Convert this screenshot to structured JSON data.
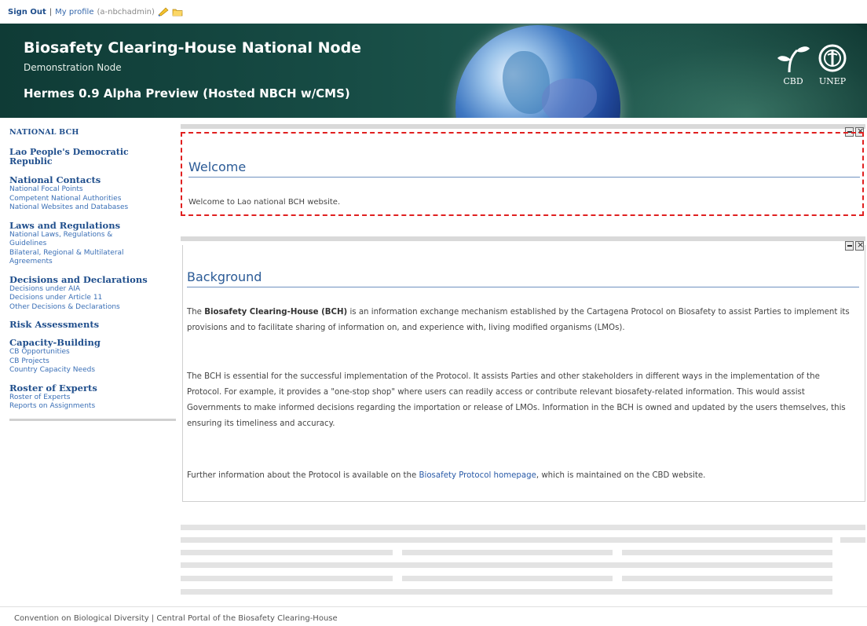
{
  "topbar": {
    "sign_out": "Sign Out",
    "separator": "|",
    "my_profile": "My profile",
    "username": "(a-nbchadmin)"
  },
  "banner": {
    "title": "Biosafety Clearing-House National Node",
    "subtitle": "Demonstration Node",
    "tag": "Hermes 0.9 Alpha Preview (Hosted NBCH w/CMS)",
    "logo_cbd": "CBD",
    "logo_unep": "UNEP"
  },
  "sidebar": {
    "heading": "NATIONAL BCH",
    "country": "Lao People's Democratic Republic",
    "sections": [
      {
        "title": "National Contacts",
        "links": [
          "National Focal Points",
          "Competent National Authorities",
          "National Websites and Databases"
        ]
      },
      {
        "title": "Laws and Regulations",
        "links": [
          "National Laws, Regulations & Guidelines",
          "Bilateral, Regional & Multilateral Agreements"
        ]
      },
      {
        "title": "Decisions and Declarations",
        "links": [
          "Decisions under AIA",
          "Decisions under Article 11",
          "Other Decisions & Declarations"
        ]
      },
      {
        "title": "Risk Assessments",
        "links": []
      },
      {
        "title": "Capacity-Building",
        "links": [
          "CB Opportunities",
          "CB Projects",
          "Country Capacity Needs"
        ]
      },
      {
        "title": "Roster of Experts",
        "links": [
          "Roster of Experts",
          "Reports on Assignments"
        ]
      }
    ]
  },
  "welcome": {
    "heading": "Welcome",
    "body": "Welcome to Lao national BCH website."
  },
  "background": {
    "heading": "Background",
    "p1_pre": "The ",
    "p1_bold": "Biosafety Clearing-House (BCH)",
    "p1_post": " is an information exchange mechanism established by the Cartagena Protocol on Biosafety to assist Parties to implement its provisions and to facilitate sharing of information on, and experience with, living modified organisms (LMOs).",
    "p2": "The BCH is essential for the successful implementation of the Protocol. It assists Parties and other stakeholders in different ways in the implementation of the Protocol. For example, it provides a \"one-stop shop\" where users can readily access or contribute relevant biosafety-related information. This would assist Governments to make informed decisions regarding the importation or release of LMOs. Information in the BCH is owned and updated by the users themselves, this ensuring its timeliness and accuracy.",
    "p3_pre": "Further information about the Protocol is available on the ",
    "p3_link": "Biosafety Protocol homepage",
    "p3_post": ", which is maintained on the CBD website."
  },
  "footer": {
    "text": "Convention on Biological Diversity | Central Portal of the Biosafety Clearing-House"
  },
  "colors": {
    "banner_bg": "#174c45",
    "link": "#3a6fb6",
    "heading": "#2a5a96",
    "dashed_border": "#e02020"
  }
}
